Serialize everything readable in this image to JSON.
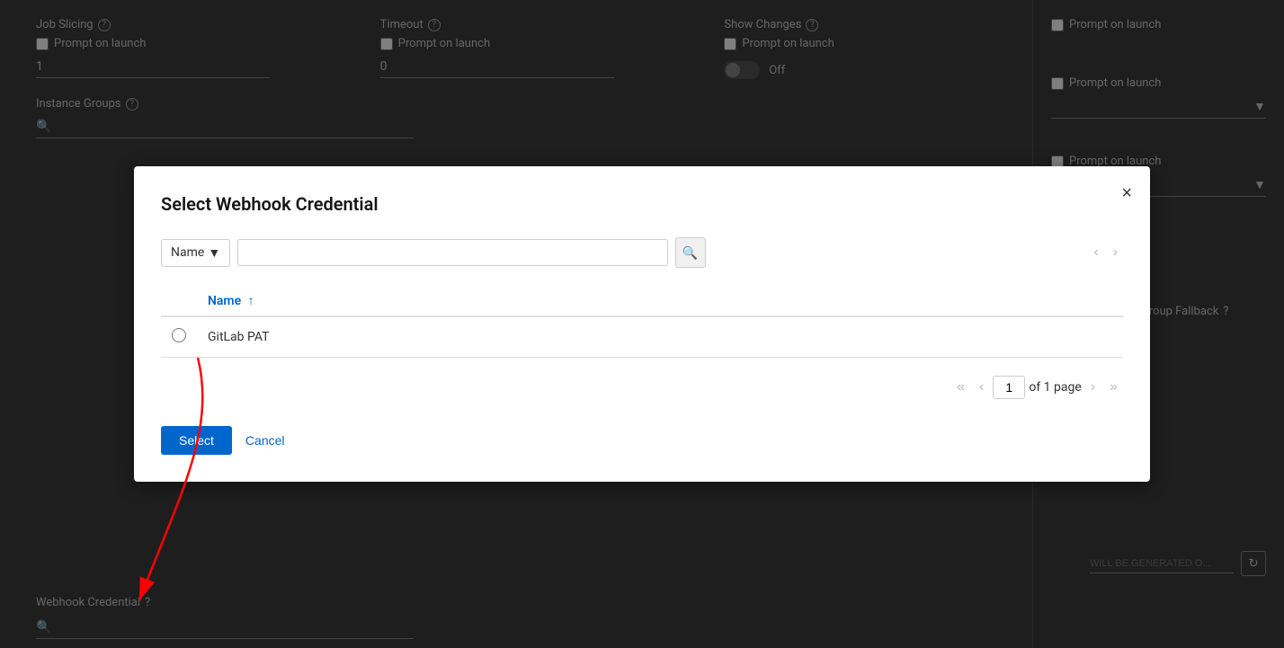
{
  "page": {
    "title": "Select Webhook Credential"
  },
  "background": {
    "job_slicing": {
      "label": "Job Slicing",
      "value": "1",
      "prompt_label": "Prompt on launch"
    },
    "timeout": {
      "label": "Timeout",
      "value": "0",
      "prompt_label": "Prompt on launch"
    },
    "show_changes": {
      "label": "Show Changes",
      "toggle_state": "Off",
      "prompt_label": "Prompt on launch"
    },
    "instance_groups": {
      "label": "Instance Groups",
      "prompt_label": "Prompt on launch"
    },
    "prompt_on_launch_1": "Prompt on launch",
    "prompt_on_launch_2": "Prompt on launch",
    "prevent_instance_group_fallback": "Prevent Instance Group Fallback",
    "webhook_key_placeholder": "WILL BE GENERATED O...",
    "webhook_credential": {
      "label": "Webhook Credential"
    }
  },
  "modal": {
    "title": "Select Webhook Credential",
    "close_label": "×",
    "search": {
      "filter_label": "Name",
      "placeholder": "",
      "search_button_icon": "🔍"
    },
    "table": {
      "columns": [
        {
          "key": "select",
          "label": ""
        },
        {
          "key": "name",
          "label": "Name",
          "sortable": true,
          "sort_direction": "asc"
        }
      ],
      "rows": [
        {
          "name": "GitLab PAT"
        }
      ]
    },
    "pagination": {
      "current_page": "1",
      "total_label": "of 1 page",
      "first_label": "«",
      "prev_label": "‹",
      "next_label": "›",
      "last_label": "»"
    },
    "footer": {
      "select_label": "Select",
      "cancel_label": "Cancel"
    }
  }
}
